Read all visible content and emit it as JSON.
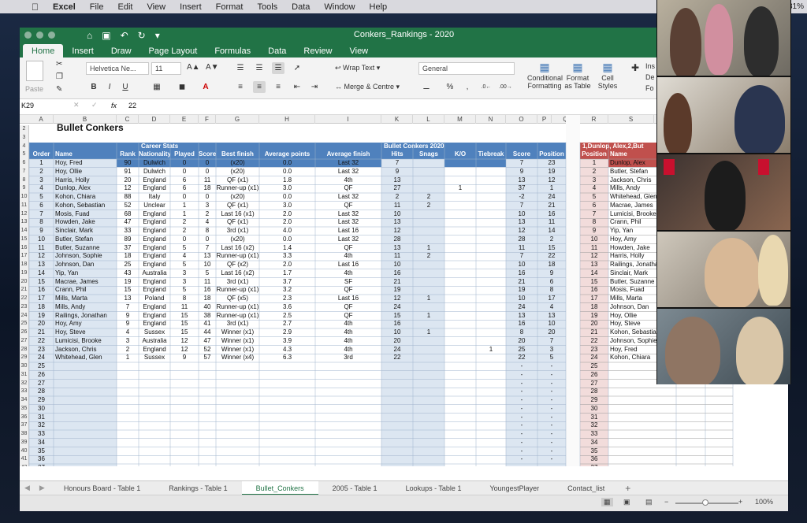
{
  "menubar": {
    "apple": "",
    "app": "Excel",
    "items": [
      "File",
      "Edit",
      "View",
      "Insert",
      "Format",
      "Tools",
      "Data",
      "Window",
      "Help"
    ],
    "battery": "81%"
  },
  "window": {
    "title": "Conkers_Rankings - 2020"
  },
  "ribbon": {
    "tabs": [
      "Home",
      "Insert",
      "Draw",
      "Page Layout",
      "Formulas",
      "Data",
      "Review",
      "View"
    ],
    "active_tab": "Home",
    "paste": "Paste",
    "font_name": "Helvetica Ne...",
    "font_size": "11",
    "wrap_text": "Wrap Text",
    "merge": "Merge & Centre",
    "number_format": "General",
    "cond_fmt": "Conditional",
    "cond_fmt2": "Formatting",
    "fmt_table": "Format",
    "fmt_table2": "as Table",
    "cell_styles": "Cell",
    "cell_styles2": "Styles",
    "ins": "Ins",
    "del": "De",
    "fo": "Fo"
  },
  "formula_bar": {
    "name_box": "K29",
    "fx": "fx",
    "value": "22"
  },
  "sheet": {
    "title": "Bullet Conkers",
    "career_stats": "Career Stats",
    "bc2020": "Bullet Conkers 2020",
    "results": [
      [
        "1",
        "Dunlop, Alex"
      ],
      [
        "2",
        "Butler, Stefan"
      ],
      [
        "3",
        "Jackson, Chris"
      ],
      [
        "4",
        "Mills, Andy"
      ],
      [
        "5",
        "Whitehead, Glen"
      ],
      [
        "6",
        "Macrae, James"
      ],
      [
        "7",
        "Lumicisi, Brooke"
      ],
      [
        "8",
        "Crann, Phil"
      ],
      [
        "9",
        "Yip, Yan"
      ],
      [
        "10",
        "Hoy, Amy"
      ],
      [
        "11",
        "Howden, Jake"
      ],
      [
        "12",
        "Harris, Holly"
      ],
      [
        "13",
        "Railings, Jonathan"
      ],
      [
        "14",
        "Sinclair, Mark"
      ],
      [
        "15",
        "Butler, Suzanne"
      ],
      [
        "16",
        "Mosis, Fuad"
      ],
      [
        "17",
        "Mills, Marta"
      ],
      [
        "18",
        "Johnson, Dan"
      ],
      [
        "19",
        "Hoy, Ollie"
      ],
      [
        "20",
        "Hoy, Steve"
      ],
      [
        "21",
        "Kohon, Sebastian"
      ],
      [
        "22",
        "Johnson, Sophie"
      ],
      [
        "23",
        "Hoy, Fred"
      ],
      [
        "24",
        "Kohon, Chiara"
      ],
      [
        "25",
        ""
      ],
      [
        "26",
        ""
      ],
      [
        "27",
        ""
      ],
      [
        "28",
        ""
      ],
      [
        "29",
        ""
      ],
      [
        "30",
        ""
      ],
      [
        "31",
        ""
      ],
      [
        "32",
        ""
      ],
      [
        "33",
        ""
      ],
      [
        "34",
        ""
      ],
      [
        "35",
        ""
      ],
      [
        "36",
        ""
      ],
      [
        "37",
        ""
      ]
    ],
    "headers": [
      "Order",
      "Name",
      "Rank",
      "Nationality",
      "Played",
      "Score",
      "Best finish",
      "Average points",
      "Average finish",
      "Hits",
      "Snags",
      "K/O",
      "Tiebreak",
      "Score",
      "Position"
    ],
    "res_headers": [
      "Position",
      "Name"
    ],
    "rows": [
      [
        "1",
        "Hoy, Fred",
        "90",
        "Dulwich",
        "0",
        "0",
        "(x20)",
        "0.0",
        "Last 32",
        "7",
        "",
        "",
        "",
        "7",
        "23"
      ],
      [
        "2",
        "Hoy, Ollie",
        "91",
        "Dulwich",
        "0",
        "0",
        "(x20)",
        "0.0",
        "Last 32",
        "9",
        "",
        "",
        "",
        "9",
        "19"
      ],
      [
        "3",
        "Harris, Holly",
        "20",
        "England",
        "6",
        "11",
        "QF (x1)",
        "1.8",
        "4th",
        "13",
        "",
        "",
        "",
        "13",
        "12"
      ],
      [
        "4",
        "Dunlop, Alex",
        "12",
        "England",
        "6",
        "18",
        "Runner-up (x1)",
        "3.0",
        "QF",
        "27",
        "",
        "1",
        "",
        "37",
        "1"
      ],
      [
        "5",
        "Kohon, Chiara",
        "88",
        "Italy",
        "0",
        "0",
        "(x20)",
        "0.0",
        "Last 32",
        "2",
        "2",
        "",
        "",
        "-2",
        "24"
      ],
      [
        "6",
        "Kohon, Sebastian",
        "52",
        "Unclear",
        "1",
        "3",
        "QF (x1)",
        "3.0",
        "QF",
        "11",
        "2",
        "",
        "",
        "7",
        "21"
      ],
      [
        "7",
        "Mosis, Fuad",
        "68",
        "England",
        "1",
        "2",
        "Last 16 (x1)",
        "2.0",
        "Last 32",
        "10",
        "",
        "",
        "",
        "10",
        "16"
      ],
      [
        "8",
        "Howden, Jake",
        "47",
        "England",
        "2",
        "4",
        "QF (x1)",
        "2.0",
        "Last 32",
        "13",
        "",
        "",
        "",
        "13",
        "11"
      ],
      [
        "9",
        "Sinclair, Mark",
        "33",
        "England",
        "2",
        "8",
        "3rd (x1)",
        "4.0",
        "Last 16",
        "12",
        "",
        "",
        "",
        "12",
        "14"
      ],
      [
        "10",
        "Butler, Stefan",
        "89",
        "England",
        "0",
        "0",
        "(x20)",
        "0.0",
        "Last 32",
        "28",
        "",
        "",
        "",
        "28",
        "2"
      ],
      [
        "11",
        "Butler, Suzanne",
        "37",
        "England",
        "5",
        "7",
        "Last 16 (x2)",
        "1.4",
        "QF",
        "13",
        "1",
        "",
        "",
        "11",
        "15"
      ],
      [
        "12",
        "Johnson, Sophie",
        "18",
        "England",
        "4",
        "13",
        "Runner-up (x1)",
        "3.3",
        "4th",
        "11",
        "2",
        "",
        "",
        "7",
        "22"
      ],
      [
        "13",
        "Johnson, Dan",
        "25",
        "England",
        "5",
        "10",
        "QF (x2)",
        "2.0",
        "Last 16",
        "10",
        "",
        "",
        "",
        "10",
        "18"
      ],
      [
        "14",
        "Yip, Yan",
        "43",
        "Australia",
        "3",
        "5",
        "Last 16 (x2)",
        "1.7",
        "4th",
        "16",
        "",
        "",
        "",
        "16",
        "9"
      ],
      [
        "15",
        "Macrae, James",
        "19",
        "England",
        "3",
        "11",
        "3rd (x1)",
        "3.7",
        "SF",
        "21",
        "",
        "",
        "",
        "21",
        "6"
      ],
      [
        "16",
        "Crann, Phil",
        "15",
        "England",
        "5",
        "16",
        "Runner-up (x1)",
        "3.2",
        "QF",
        "19",
        "",
        "",
        "",
        "19",
        "8"
      ],
      [
        "17",
        "Mills, Marta",
        "13",
        "Poland",
        "8",
        "18",
        "QF (x5)",
        "2.3",
        "Last 16",
        "12",
        "1",
        "",
        "",
        "10",
        "17"
      ],
      [
        "18",
        "Mills, Andy",
        "7",
        "England",
        "11",
        "40",
        "Runner-up (x1)",
        "3.6",
        "QF",
        "24",
        "",
        "",
        "",
        "24",
        "4"
      ],
      [
        "19",
        "Railings, Jonathan",
        "9",
        "England",
        "15",
        "38",
        "Runner-up (x1)",
        "2.5",
        "QF",
        "15",
        "1",
        "",
        "",
        "13",
        "13"
      ],
      [
        "20",
        "Hoy, Amy",
        "9",
        "England",
        "15",
        "41",
        "3rd (x1)",
        "2.7",
        "4th",
        "16",
        "",
        "",
        "",
        "16",
        "10"
      ],
      [
        "21",
        "Hoy, Steve",
        "4",
        "Sussex",
        "15",
        "44",
        "Winner (x1)",
        "2.9",
        "4th",
        "10",
        "1",
        "",
        "",
        "8",
        "20"
      ],
      [
        "22",
        "Lumicisi, Brooke",
        "3",
        "Australia",
        "12",
        "47",
        "Winner (x1)",
        "3.9",
        "4th",
        "20",
        "",
        "",
        "",
        "20",
        "7"
      ],
      [
        "23",
        "Jackson, Chris",
        "2",
        "England",
        "12",
        "52",
        "Winner (x1)",
        "4.3",
        "4th",
        "24",
        "",
        "",
        "1",
        "25",
        "3"
      ],
      [
        "24",
        "Whitehead, Glen",
        "1",
        "Sussex",
        "9",
        "57",
        "Winner (x4)",
        "6.3",
        "3rd",
        "22",
        "",
        "",
        "",
        "22",
        "5"
      ]
    ],
    "empty_orders": [
      "25",
      "26",
      "27",
      "28",
      "29",
      "30",
      "31",
      "32",
      "33",
      "34",
      "35",
      "36",
      "37"
    ],
    "col_letters": [
      "A",
      "B",
      "C",
      "D",
      "E",
      "F",
      "G",
      "H",
      "I",
      "K",
      "L",
      "M",
      "N",
      "O",
      "P",
      "Q",
      "R",
      "S"
    ],
    "row_numbers": [
      "2",
      "3",
      "4",
      "5",
      "6",
      "7",
      "8",
      "9",
      "10",
      "11",
      "12",
      "13",
      "14",
      "15",
      "16",
      "17",
      "18",
      "19",
      "20",
      "21",
      "22",
      "23",
      "24",
      "25",
      "26",
      "27",
      "28",
      "29",
      "30",
      "31",
      "32",
      "33",
      "34",
      "35",
      "36",
      "37",
      "38",
      "39",
      "40",
      "41",
      "42"
    ]
  },
  "sheet_tabs": [
    "Honours Board - Table 1",
    "Rankings - Table 1",
    "Bullet_Conkers",
    "2005 - Table 1",
    "Lookups - Table 1",
    "YoungestPlayer",
    "Contact_list"
  ],
  "active_sheet": "Bullet_Conkers",
  "zoom": "100%",
  "colors": {
    "excel_green": "#217346",
    "header_blue": "#4f81bd",
    "light_blue": "#dce6f1",
    "results_red": "#c0504d"
  }
}
